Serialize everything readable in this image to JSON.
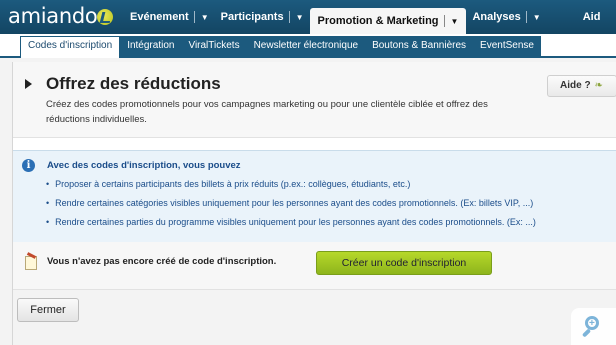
{
  "app": {
    "logo_text": "amiando"
  },
  "nav": [
    {
      "label": "Evénement"
    },
    {
      "label": "Participants"
    },
    {
      "label": "Promotion & Marketing"
    },
    {
      "label": "Analyses"
    },
    {
      "label": "Aid"
    }
  ],
  "subtabs": [
    {
      "label": "Codes d'inscription"
    },
    {
      "label": "Intégration"
    },
    {
      "label": "ViralTickets"
    },
    {
      "label": "Newsletter électronique"
    },
    {
      "label": "Boutons & Bannières"
    },
    {
      "label": "EventSense"
    }
  ],
  "header": {
    "title": "Offrez des réductions",
    "description": "Créez des codes promotionnels pour vos campagnes marketing ou pour une clientèle ciblée et offrez des réductions individuelles.",
    "help_label": "Aide ?"
  },
  "info": {
    "title": "Avec des codes d'inscription, vous pouvez",
    "items": [
      "Proposer à certains participants des billets à prix réduits (p.ex.: collègues, étudiants, etc.)",
      "Rendre certaines catégories visibles uniquement pour les personnes ayant des codes promotionnels. (Ex: billets VIP, ...)",
      "Rendre certaines parties du programme visibles uniquement pour les personnes ayant des codes promotionnels. (Ex: ...)"
    ]
  },
  "cta": {
    "text": "Vous n'avez pas encore créé de code d'inscription.",
    "button_label": "Créer un code d'inscription",
    "button_color": "#a3c823"
  },
  "footer": {
    "close_label": "Fermer"
  },
  "colors": {
    "brand": "#1c5a7e",
    "info_bg": "#eaf3fa",
    "info_text": "#1b4d8a"
  }
}
